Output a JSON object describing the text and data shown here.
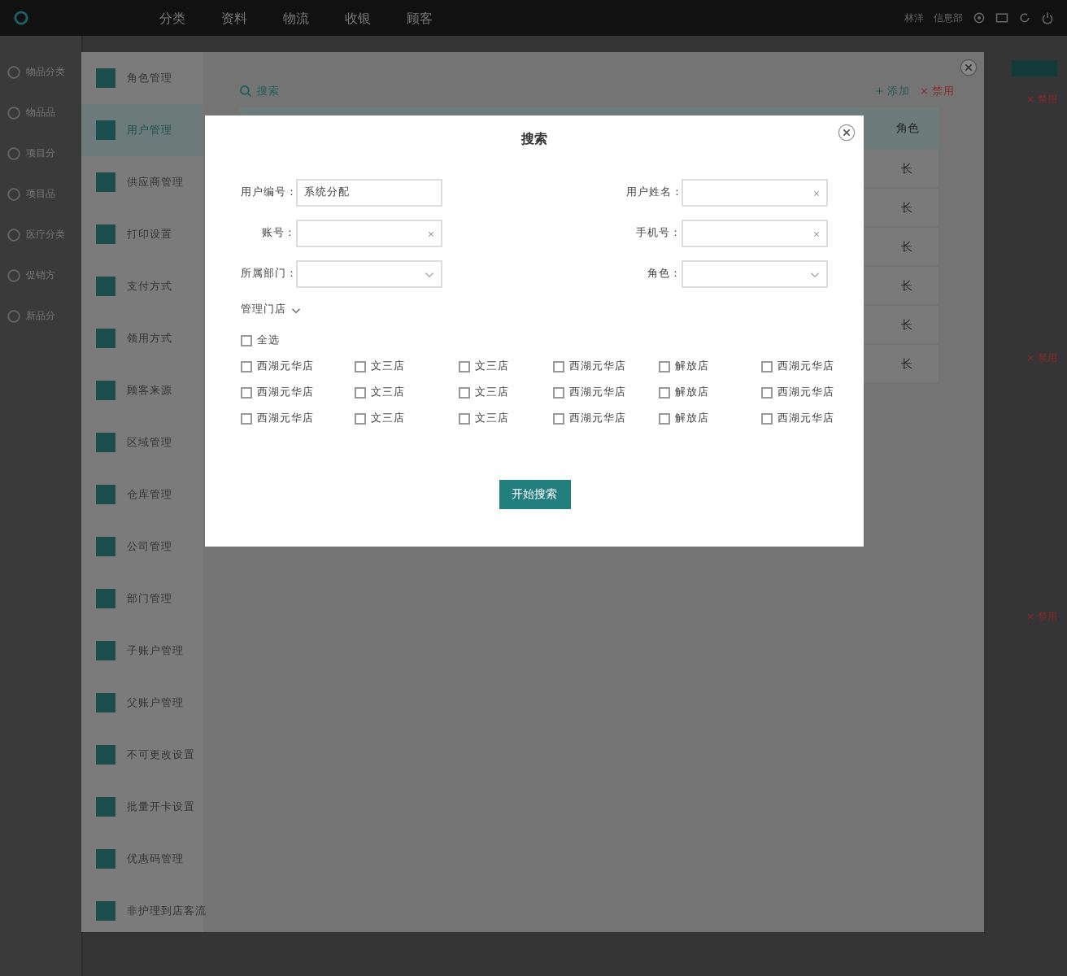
{
  "top_bar": {
    "nav": [
      "分类",
      "资料",
      "物流",
      "收银",
      "顾客"
    ],
    "user": [
      "林洋",
      "信息部"
    ]
  },
  "sidebar": {
    "items": [
      "物品分类",
      "物品品",
      "项目分",
      "项目品",
      "医疗分类",
      "促销方",
      "新品分"
    ]
  },
  "right_strip": {
    "actions": [
      "× 禁用",
      "× 禁用",
      "× 禁用"
    ]
  },
  "panel": {
    "menu": [
      {
        "label": "角色管理",
        "selected": false
      },
      {
        "label": "用户管理",
        "selected": true
      },
      {
        "label": "供应商管理",
        "selected": false
      },
      {
        "label": "打印设置",
        "selected": false
      },
      {
        "label": "支付方式",
        "selected": false
      },
      {
        "label": "领用方式",
        "selected": false
      },
      {
        "label": "顾客来源",
        "selected": false
      },
      {
        "label": "区域管理",
        "selected": false
      },
      {
        "label": "仓库管理",
        "selected": false
      },
      {
        "label": "公司管理",
        "selected": false
      },
      {
        "label": "部门管理",
        "selected": false
      },
      {
        "label": "子账户管理",
        "selected": false
      },
      {
        "label": "父账户管理",
        "selected": false
      },
      {
        "label": "不可更改设置",
        "selected": false
      },
      {
        "label": "批量开卡设置",
        "selected": false
      },
      {
        "label": "优惠码管理",
        "selected": false
      },
      {
        "label": "非护理到店客流",
        "selected": false
      }
    ],
    "search": "搜索",
    "add": "+ 添加",
    "disable": "× 禁用",
    "column": "角色",
    "rows": [
      "长",
      "长",
      "长",
      "长",
      "长",
      "长"
    ]
  },
  "dialog": {
    "title": "搜索",
    "fields": [
      {
        "label": "用户编号：",
        "value": "系统分配",
        "kind": "text"
      },
      {
        "label": "用户姓名：",
        "kind": "clear"
      },
      {
        "label": "账号：",
        "kind": "clear"
      },
      {
        "label": "手机号：",
        "kind": "clear"
      },
      {
        "label": "所属部门：",
        "kind": "select"
      },
      {
        "label": "角色：",
        "kind": "select"
      }
    ],
    "stores_label": "管理门店",
    "expanded": true,
    "select_all": {
      "label": "全选",
      "checked": false
    },
    "stores": [
      {
        "label": "西湖元华店",
        "checked": false
      },
      {
        "label": "文三店",
        "checked": false
      },
      {
        "label": "文三店",
        "checked": false
      },
      {
        "label": "西湖元华店",
        "checked": false
      },
      {
        "label": "解放店",
        "checked": false
      },
      {
        "label": "西湖元华店",
        "checked": false
      },
      {
        "label": "西湖元华店",
        "checked": false
      },
      {
        "label": "文三店",
        "checked": false
      },
      {
        "label": "文三店",
        "checked": false
      },
      {
        "label": "西湖元华店",
        "checked": false
      },
      {
        "label": "解放店",
        "checked": false
      },
      {
        "label": "西湖元华店",
        "checked": false
      },
      {
        "label": "西湖元华店",
        "checked": false
      },
      {
        "label": "文三店",
        "checked": false
      },
      {
        "label": "文三店",
        "checked": false
      },
      {
        "label": "西湖元华店",
        "checked": false
      },
      {
        "label": "解放店",
        "checked": false
      },
      {
        "label": "西湖元华店",
        "checked": false
      }
    ],
    "submit": "开始搜索"
  }
}
